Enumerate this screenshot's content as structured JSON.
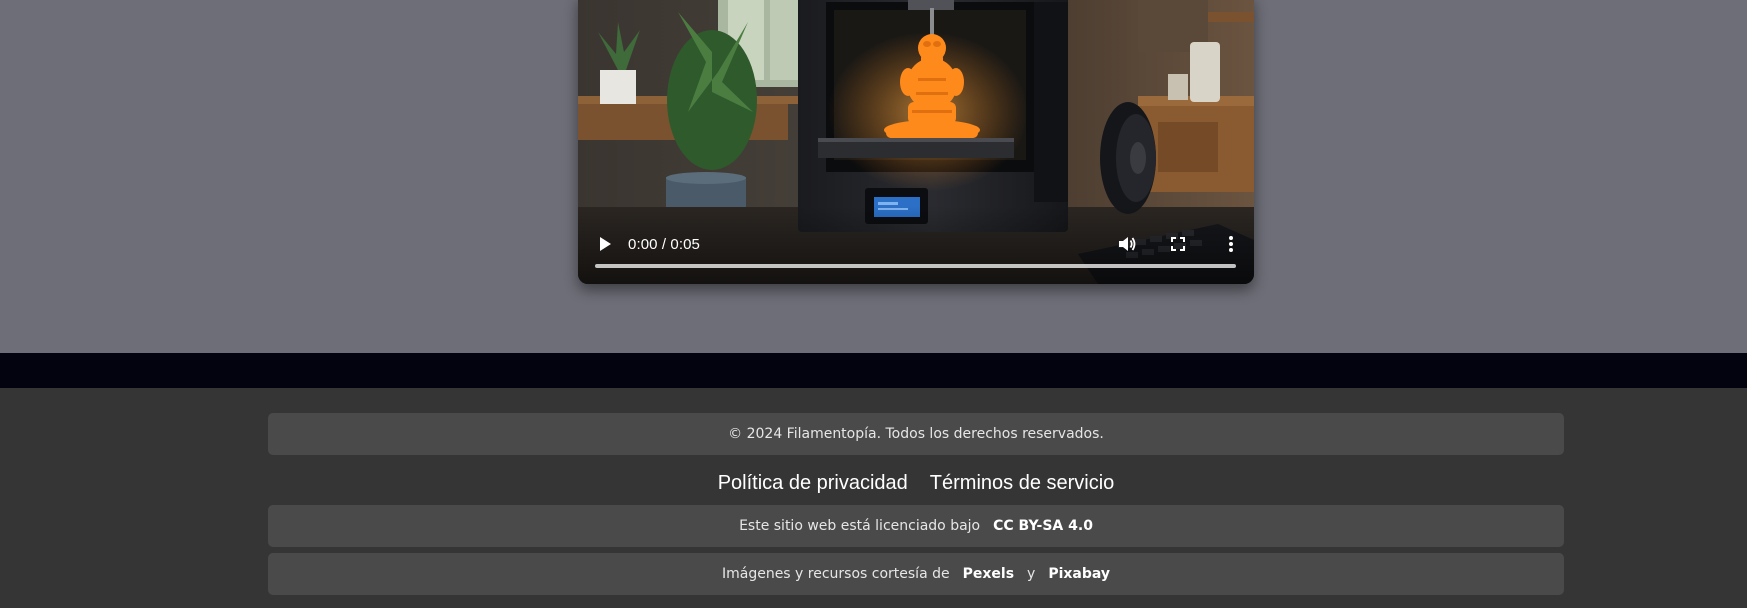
{
  "video": {
    "time": "0:00 / 0:05",
    "progress": 0,
    "icons": {
      "play": "play-icon",
      "volume": "volume-icon",
      "fullscreen": "fullscreen-icon",
      "more": "more-vert-icon"
    }
  },
  "footer": {
    "copyright": "© 2024 Filamentopía. Todos los derechos reservados.",
    "links": {
      "privacy": "Política de privacidad",
      "terms": "Términos de servicio"
    },
    "license": {
      "text": "Este sitio web está licenciado bajo",
      "link": "CC BY-SA 4.0"
    },
    "credits": {
      "text": "Imágenes y recursos cortesía de",
      "link1": "Pexels",
      "separator": "y",
      "link2": "Pixabay"
    }
  },
  "colors": {
    "page_background": "#6e6e78",
    "dark_band": "#03030f",
    "footer_background": "#353535",
    "footer_box": "#4a4a4a",
    "filament_orange": "#ff8a1c"
  }
}
